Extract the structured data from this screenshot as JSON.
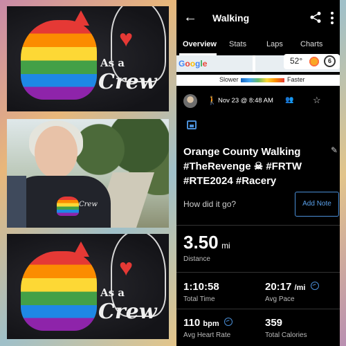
{
  "collage": {
    "shirt_text_small": "As a",
    "shirt_text_large": "Crew"
  },
  "activity": {
    "header_title": "Walking",
    "tabs": [
      "Overview",
      "Stats",
      "Laps",
      "Charts"
    ],
    "active_tab": "Overview",
    "map": {
      "brand": "Google",
      "temperature": "52°",
      "uv_index": "6"
    },
    "pace_legend": {
      "slower": "Slower",
      "faster": "Faster"
    },
    "date": "Nov 23 @ 8:48 AM",
    "title": "Orange County Walking #TheRevenge ☠ #FRTW #RTE2024 #Racery",
    "prompt": "How did it go?",
    "add_note": "Add Note",
    "distance": {
      "value": "3.50",
      "unit": "mi",
      "label": "Distance"
    },
    "total_time": {
      "value": "1:10:58",
      "label": "Total Time"
    },
    "avg_pace": {
      "value": "20:17",
      "unit": "/mi",
      "label": "Avg Pace"
    },
    "avg_hr": {
      "value": "110",
      "unit": "bpm",
      "label": "Avg Heart Rate"
    },
    "calories": {
      "value": "359",
      "label": "Total Calories"
    },
    "colors": {
      "accent": "#4a8fd8",
      "background": "#000000"
    }
  }
}
